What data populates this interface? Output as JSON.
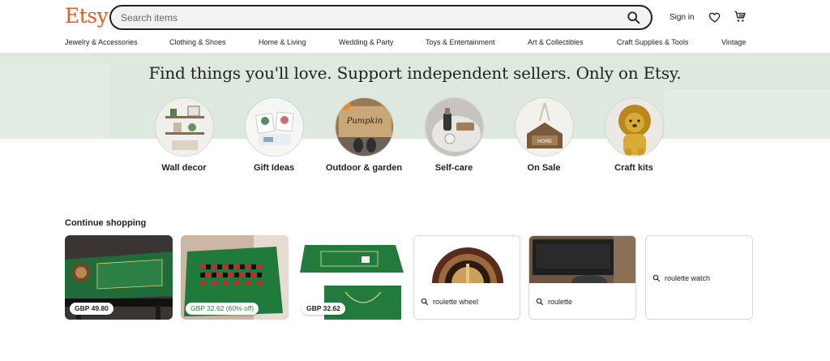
{
  "header": {
    "logo": "Etsy",
    "search_placeholder": "Search items",
    "signin_label": "Sign in"
  },
  "nav": {
    "items": [
      "Jewelry & Accessories",
      "Clothing & Shoes",
      "Home & Living",
      "Wedding & Party",
      "Toys & Entertainment",
      "Art & Collectibles",
      "Craft Supplies & Tools",
      "Vintage"
    ]
  },
  "hero": {
    "title": "Find things you'll love. Support independent sellers. Only on Etsy."
  },
  "categories": [
    {
      "label": "Wall decor"
    },
    {
      "label": "Gift Ideas"
    },
    {
      "label": "Outdoor & garden"
    },
    {
      "label": "Self-care"
    },
    {
      "label": "On Sale"
    },
    {
      "label": "Craft kits"
    }
  ],
  "continue_shopping": {
    "title": "Continue shopping",
    "items": [
      {
        "price": "GBP 49.80"
      },
      {
        "price": "GBP 32.62 (60% off)"
      },
      {
        "price": "GBP 32.62"
      },
      {
        "query": "roulette wheel"
      },
      {
        "query": "roulette"
      },
      {
        "query": "roulette watch"
      }
    ]
  },
  "colors": {
    "brand": "#e25c1c",
    "hero_band": "#dde9de",
    "sale_green": "#258635"
  }
}
